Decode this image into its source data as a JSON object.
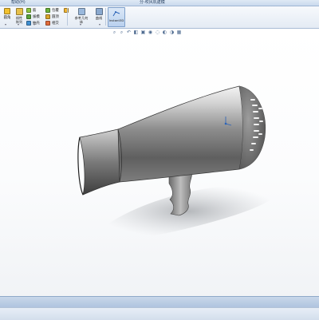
{
  "window": {
    "menu": [
      "",
      "帮助(H)",
      ""
    ],
    "title": "分-吹风机建模"
  },
  "ribbon": {
    "items": {
      "btn_a": "圆角",
      "btn_b": "线性阵列",
      "btn_c": "筋",
      "btn_d": "拔模",
      "btn_e": "抽壳",
      "btn_f": "包覆",
      "btn_g": "圆顶",
      "btn_h": "相交",
      "btn_i": "参考几何体",
      "btn_j": "曲线",
      "btn_k": "Instant3D"
    }
  },
  "status": {
    "text": ""
  },
  "colors": {
    "accent": "#2b63b8",
    "ribbon_bg": "#e9eff7",
    "model_gray": "#8c8c8c"
  }
}
